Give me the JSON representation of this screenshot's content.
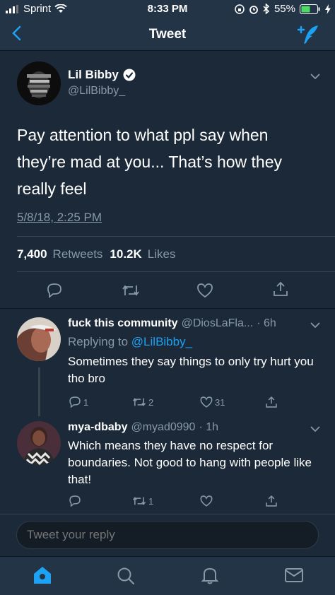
{
  "status": {
    "carrier": "Sprint",
    "time": "8:33 PM",
    "battery": "55%"
  },
  "nav": {
    "title": "Tweet"
  },
  "tweet": {
    "author_name": "Lil Bibby",
    "handle": "@LilBibby_",
    "text": "Pay attention to what ppl say when they’re mad at you... That’s how they really feel",
    "date": "5/8/18, 2:25 PM",
    "retweets_count": "7,400",
    "retweets_label": "Retweets",
    "likes_count": "10.2K",
    "likes_label": "Likes"
  },
  "replies": [
    {
      "name": "fuck this community",
      "handle": "@DiosLaFla...",
      "time": "· 6h",
      "replying_prefix": "Replying to",
      "replying_to": "@LilBibby_",
      "text": "Sometimes they say things to only try hurt you tho bro",
      "reply_count": "1",
      "retweet_count": "2",
      "like_count": "31"
    },
    {
      "name": "mya-dbaby",
      "handle": "@myad0990",
      "time": "· 1h",
      "text": "Which means they have no respect for boundaries.  Not good to hang with people like that!",
      "reply_count": "",
      "retweet_count": "1",
      "like_count": ""
    }
  ],
  "compose": {
    "placeholder": "Tweet your reply"
  },
  "colors": {
    "background": "#141d26",
    "card": "#1c2938",
    "bar": "#243447",
    "accent": "#1da1f2",
    "muted": "#8899a6"
  },
  "icons": [
    "back-arrow-icon",
    "compose-tweet-icon",
    "verified-icon",
    "chevron-down-icon",
    "reply-icon",
    "retweet-icon",
    "like-icon",
    "share-icon",
    "home-icon",
    "search-icon",
    "notifications-icon",
    "messages-icon"
  ]
}
